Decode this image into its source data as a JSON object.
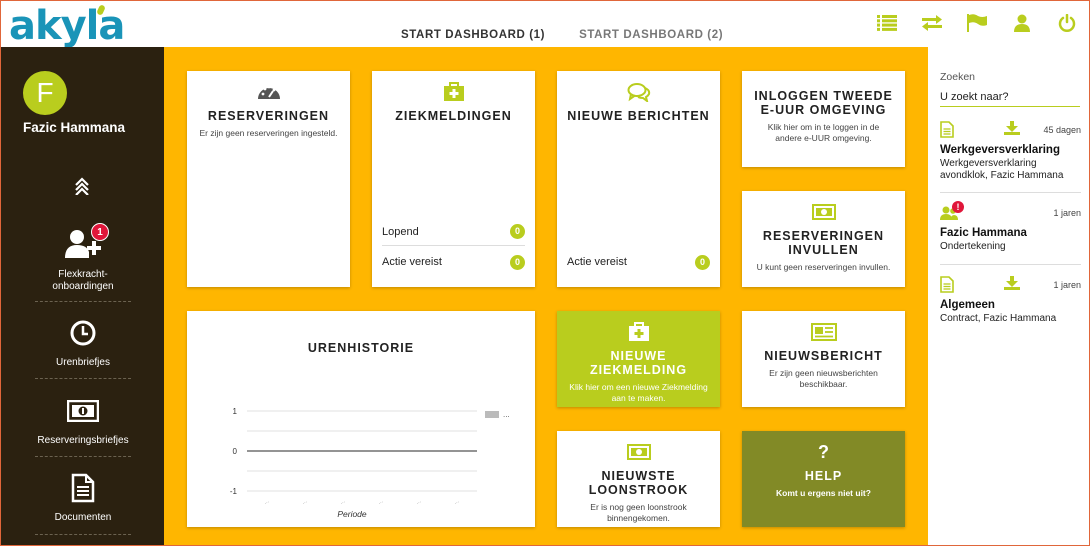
{
  "app": {
    "logo_text": "akyla"
  },
  "tabs": [
    {
      "label": "START DASHBOARD (1)",
      "active": true
    },
    {
      "label": "START DASHBOARD (2)",
      "active": false
    }
  ],
  "header_icons": [
    "list-icon",
    "swap-icon",
    "flag-icon",
    "user-icon",
    "power-icon"
  ],
  "user": {
    "initial": "F",
    "name": "Fazic Hammana"
  },
  "sidebar": {
    "items": [
      {
        "label": "Flexkracht-\nonboardingen",
        "icon": "add-user-icon",
        "badge": "1"
      },
      {
        "label": "Urenbriefjes",
        "icon": "clock-icon"
      },
      {
        "label": "Reserveringsbriefjes",
        "icon": "money-icon"
      },
      {
        "label": "Documenten",
        "icon": "document-icon"
      }
    ]
  },
  "tiles": {
    "reserveringen": {
      "title": "RESERVERINGEN",
      "desc": "Er zijn geen reserveringen ingesteld."
    },
    "ziekmeldingen": {
      "title": "ZIEKMELDINGEN",
      "stats": [
        {
          "label": "Lopend",
          "count": "0"
        },
        {
          "label": "Actie vereist",
          "count": "0"
        }
      ]
    },
    "berichten": {
      "title": "NIEUWE BERICHTEN",
      "stats": [
        {
          "label": "Actie vereist",
          "count": "0"
        }
      ]
    },
    "inloggen": {
      "title": "INLOGGEN TWEEDE E-UUR OMGEVING",
      "desc": "Klik hier om in te loggen in de andere e-UUR omgeving."
    },
    "reserveringen_invullen": {
      "title": "RESERVERINGEN INVULLEN",
      "desc": "U kunt geen reserveringen invullen."
    },
    "urenhistorie": {
      "title": "URENHISTORIE"
    },
    "nieuwe_ziekmelding": {
      "title": "NIEUWE ZIEKMELDING",
      "desc": "Klik hier om een nieuwe Ziekmelding aan te maken."
    },
    "nieuwsbericht": {
      "title": "NIEUWSBERICHT",
      "desc": "Er zijn geen nieuwsberichten beschikbaar."
    },
    "loonstrook": {
      "title": "NIEUWSTE LOONSTROOK",
      "desc": "Er is nog geen loonstrook binnengekomen."
    },
    "help": {
      "symbol": "?",
      "title": "HELP",
      "desc": "Komt u ergens niet uit?"
    }
  },
  "chart_data": {
    "type": "line",
    "title": "URENHISTORIE",
    "xlabel": "Periode",
    "ylabel": "",
    "yticks": [
      "1",
      "0",
      "-1"
    ],
    "ylim": [
      -1,
      1
    ],
    "xticks": [
      "...",
      "...",
      "...",
      "...",
      "...",
      "..."
    ],
    "legend": [
      {
        "name": "...",
        "color": "#bbbbbb"
      }
    ],
    "legend_position": "right",
    "grid": true,
    "series": [
      {
        "values": [
          0,
          0,
          0,
          0,
          0,
          0
        ]
      }
    ]
  },
  "right_panel": {
    "search_label": "Zoeken",
    "search_placeholder": "U zoekt naar?",
    "documents": [
      {
        "age": "45 dagen",
        "title": "Werkgeversverklaring",
        "subtitle": "Werkgeversverklaring avondklok, Fazic Hammana",
        "icon": "document-icon",
        "download": true
      },
      {
        "age": "1 jaren",
        "title": "Fazic Hammana",
        "subtitle": "Ondertekening",
        "icon": "user-group-icon",
        "alert": "!"
      },
      {
        "age": "1 jaren",
        "title": "Algemeen",
        "subtitle": "Contract, Fazic Hammana",
        "icon": "document-icon",
        "download": true
      }
    ]
  },
  "colors": {
    "accent": "#b9cd1e",
    "dashboard_bg": "#ffb600",
    "sidebar_bg": "#2b2110",
    "olive": "#828a26",
    "badge_red": "#e0163a",
    "logo_blue": "#1a94b8"
  }
}
